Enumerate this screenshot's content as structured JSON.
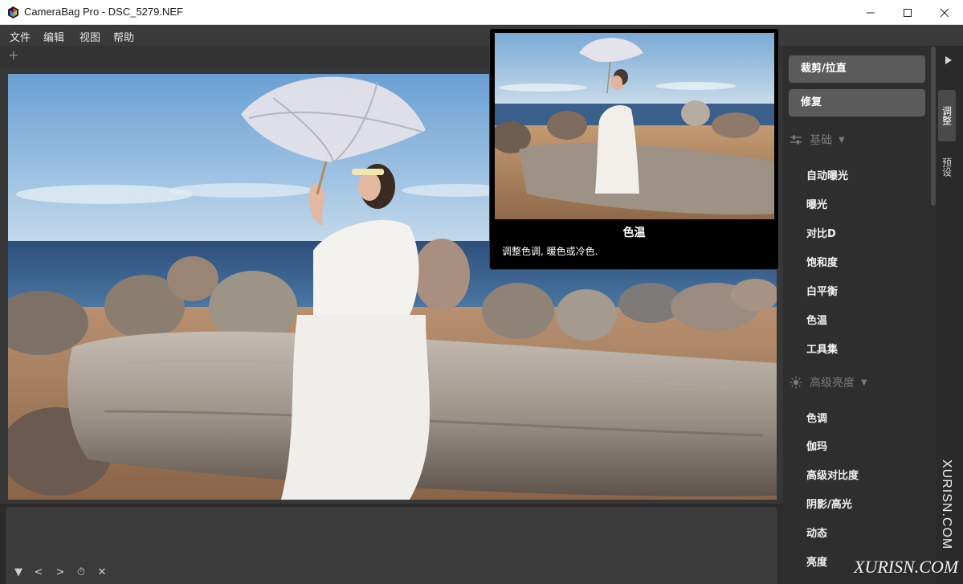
{
  "window": {
    "title": "CameraBag Pro - DSC_5279.NEF",
    "app_icon": "camerabag-logo-icon",
    "controls": [
      "minimize-icon",
      "maximize-icon",
      "close-icon"
    ]
  },
  "menu": {
    "items": [
      "文件",
      "编辑",
      "视图",
      "帮助"
    ]
  },
  "tabstrip": {
    "add_label": "+"
  },
  "photo": {
    "description_icon": "photo-preview"
  },
  "bottom_toolbar": {
    "icons": [
      "▼",
      "<",
      ">",
      "⏱",
      "✕"
    ]
  },
  "right_panel": {
    "buttons": [
      "裁剪/拉直",
      "修复"
    ],
    "sections": [
      {
        "title": "基础",
        "icon": "sliders-icon",
        "items": [
          "自动曝光",
          "曝光",
          "对比D",
          "饱和度",
          "白平衡",
          "色温",
          "工具集"
        ]
      },
      {
        "title": "高级亮度",
        "icon": "sun-icon",
        "items": [
          "色调",
          "伽玛",
          "高级对比度",
          "阴影/高光",
          "动态",
          "亮度"
        ]
      }
    ],
    "tabs": [
      "调整",
      "预设"
    ]
  },
  "tooltip": {
    "title": "色温",
    "description": "调整色调, 暖色或冷色."
  },
  "watermark": {
    "vertical": "XURISN.COM",
    "horizontal": "XURISN.COM"
  }
}
